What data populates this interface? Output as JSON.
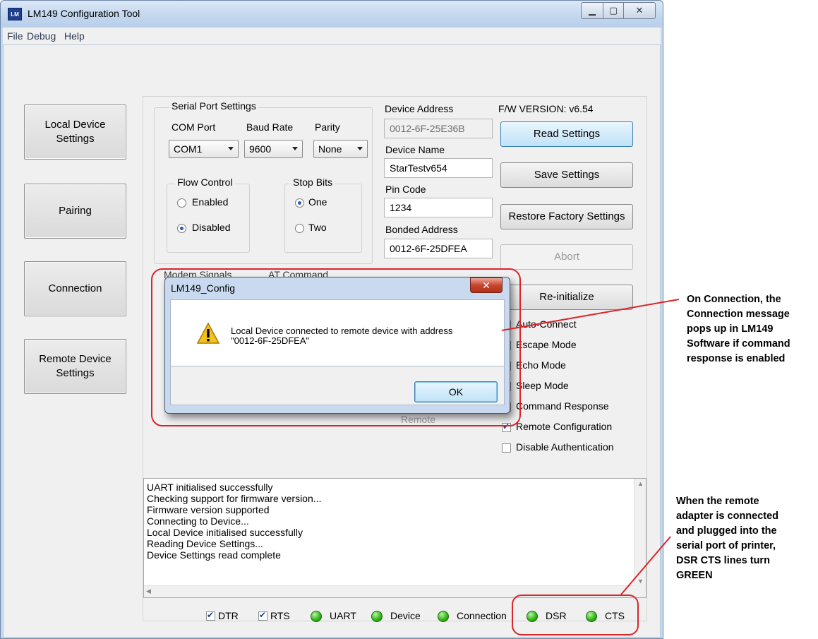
{
  "window": {
    "title": "LM149 Configuration Tool",
    "icon_text": "LM"
  },
  "menu": [
    "File",
    "Debug",
    "Help"
  ],
  "nav": {
    "local_device_settings": "Local Device Settings",
    "pairing": "Pairing",
    "connection": "Connection",
    "remote_device_settings": "Remote Device Settings"
  },
  "serial": {
    "group_label": "Serial Port Settings",
    "com_port_label": "COM Port",
    "com_port_value": "COM1",
    "baud_rate_label": "Baud Rate",
    "baud_rate_value": "9600",
    "parity_label": "Parity",
    "parity_value": "None",
    "flow_control_label": "Flow Control",
    "flow_enabled": "Enabled",
    "flow_disabled": "Disabled",
    "stop_bits_label": "Stop Bits",
    "stop_one": "One",
    "stop_two": "Two"
  },
  "device": {
    "address_label": "Device Address",
    "address_value": "0012-6F-25E36B",
    "name_label": "Device Name",
    "name_value": "StarTestv654",
    "pin_label": "Pin Code",
    "pin_value": "1234",
    "bonded_label": "Bonded Address",
    "bonded_value": "0012-6F-25DFEA"
  },
  "hidden_labels": {
    "modem_signals": "Modem Signals",
    "at_command": "AT Command",
    "remote": "Remote"
  },
  "fw_version": "F/W VERSION: v6.54",
  "buttons": {
    "read_settings": "Read Settings",
    "save_settings": "Save Settings",
    "restore_factory": "Restore Factory Settings",
    "abort": "Abort",
    "reinitialize": "Re-initialize"
  },
  "options": {
    "auto_connect": "Auto-Connect",
    "escape_mode": "Escape Mode",
    "echo_mode": "Echo Mode",
    "sleep_mode": "Sleep Mode",
    "command_response": "Command Response",
    "remote_configuration": "Remote Configuration",
    "disable_authentication": "Disable Authentication"
  },
  "log": [
    "UART initialised successfully",
    "Checking support for firmware version...",
    "Firmware version supported",
    "Connecting to Device...",
    "Local Device initialised successfully",
    "Reading Device Settings...",
    "Device Settings read complete"
  ],
  "status": {
    "dtr": "DTR",
    "rts": "RTS",
    "uart": "UART",
    "device": "Device",
    "connection": "Connection",
    "dsr": "DSR",
    "cts": "CTS",
    "led_color": "#36b81d"
  },
  "dialog": {
    "title": "LM149_Config",
    "message_line1": "Local Device connected to remote device with address",
    "message_line2": "\"0012-6F-25DFEA\"",
    "ok_label": "OK"
  },
  "annotations": {
    "connection_note": [
      "On Connection, the",
      "Connection message",
      "pops up in LM149",
      "Software if command",
      "response is enabled"
    ],
    "remote_note": [
      "When the remote",
      "adapter is connected",
      "and plugged into the",
      "serial port of printer,",
      "DSR CTS lines turn",
      "GREEN"
    ],
    "highlight_color": "#d9262b"
  }
}
